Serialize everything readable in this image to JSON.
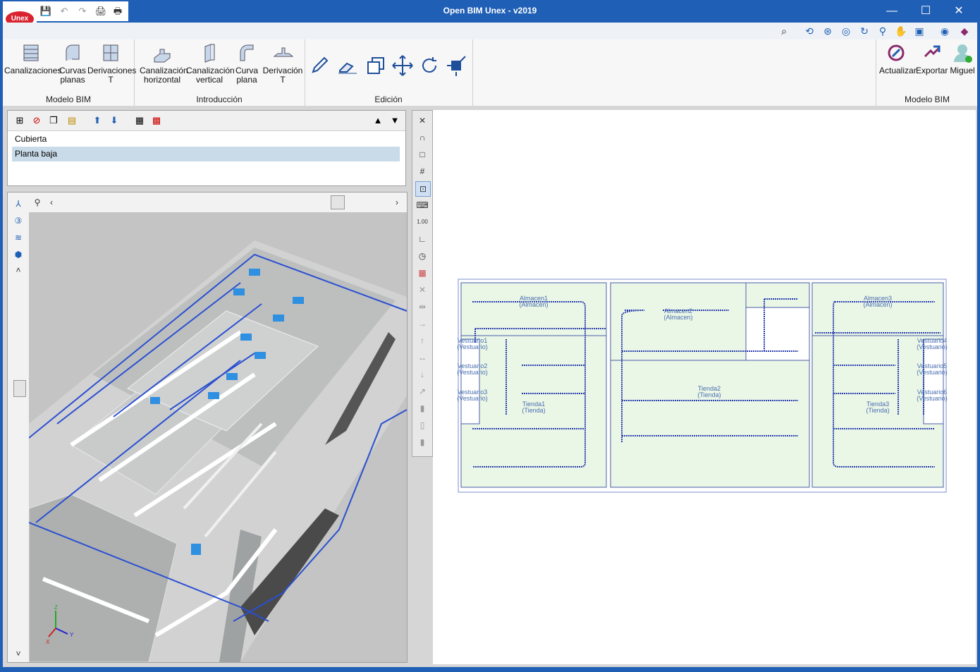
{
  "window": {
    "title": "Open BIM Unex - v2019",
    "minimize": "—",
    "maximize": "☐",
    "close": "✕"
  },
  "logo": {
    "text": "Unex"
  },
  "qat": {
    "icons": [
      "save-icon",
      "undo-icon",
      "redo-icon",
      "print-icon",
      "print-preview-icon"
    ],
    "glyphs": [
      "💾",
      "↶",
      "↷",
      "🖨",
      "🖶"
    ]
  },
  "toolbar2": {
    "icons": [
      "binoculars-icon",
      "zoom-window-icon",
      "zoom-all-icon",
      "zoom-previous-icon",
      "redraw-icon",
      "zoom-icon",
      "pan-icon",
      "view-icon",
      "globe-icon",
      "book-icon"
    ]
  },
  "ribbon": {
    "groups": [
      {
        "label": "Modelo BIM",
        "buttons": [
          "Canalizaciones",
          "Curvas planas",
          "Derivaciones T"
        ]
      },
      {
        "label": "Introducción",
        "buttons": [
          "Canalización horizontal",
          "Canalización vertical",
          "Curva plana",
          "Derivación T"
        ]
      },
      {
        "label": "Edición",
        "buttons": []
      },
      {
        "label": "Modelo BIM",
        "buttons": [
          "Actualizar",
          "Exportar",
          "Miguel"
        ]
      }
    ],
    "labels": {
      "canalizaciones": "Canalizaciones",
      "curvas_1": "Curvas",
      "curvas_2": "planas",
      "deriv_1": "Derivaciones",
      "deriv_2": "T",
      "canh_1": "Canalización",
      "canh_2": "horizontal",
      "canv_1": "Canalización",
      "canv_2": "vertical",
      "curva_1": "Curva",
      "curva_2": "plana",
      "dert_1": "Derivación",
      "dert_2": "T",
      "actualizar": "Actualizar",
      "exportar": "Exportar",
      "miguel": "Miguel"
    },
    "group_labels": {
      "g1": "Modelo BIM",
      "g2": "Introducción",
      "g3": "Edición",
      "g4": "Modelo BIM"
    }
  },
  "layers": {
    "items": [
      "Cubierta",
      "Planta baja"
    ],
    "selected": "Planta baja"
  },
  "view3d": {
    "axes": {
      "x": "X",
      "y": "Y",
      "z": "Z"
    }
  },
  "plan": {
    "rooms": [
      {
        "name": "Almacen1",
        "type": "(Almacen)"
      },
      {
        "name": "Almacen2",
        "type": "(Almacen)"
      },
      {
        "name": "Almacen3",
        "type": "(Almacen)"
      },
      {
        "name": "Tienda1",
        "type": "(Tienda)"
      },
      {
        "name": "Tienda2",
        "type": "(Tienda)"
      },
      {
        "name": "Tienda3",
        "type": "(Tienda)"
      },
      {
        "name": "Vestuario1",
        "type": "(Vestuario)"
      },
      {
        "name": "Vestuario2",
        "type": "(Vestuario)"
      },
      {
        "name": "Vestuario3",
        "type": "(Vestuario)"
      },
      {
        "name": "Vestuario4",
        "type": "(Vestuario)"
      },
      {
        "name": "Vestuario5",
        "type": "(Vestuario)"
      },
      {
        "name": "Vestuario6",
        "type": "(Vestuario)"
      }
    ]
  },
  "colors": {
    "titlebar": "#1f5fb5",
    "plan_room_fill": "#eaf6e6",
    "pipe": "#2a3fb0",
    "selected_row": "#c9dbe8"
  }
}
